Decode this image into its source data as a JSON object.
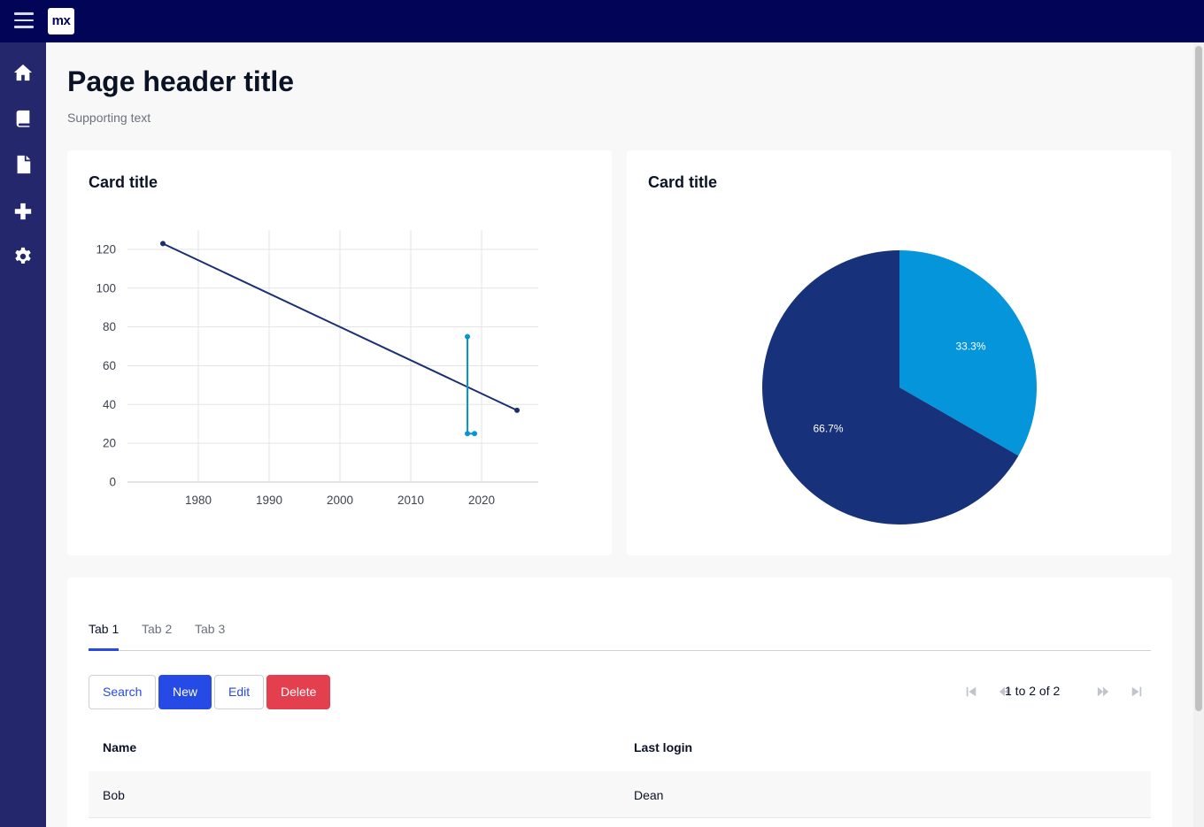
{
  "app": {
    "logo_text": "mx"
  },
  "sidebar": {
    "items": [
      {
        "icon": "home-icon"
      },
      {
        "icon": "book-icon"
      },
      {
        "icon": "file-icon"
      },
      {
        "icon": "plus-icon"
      },
      {
        "icon": "gear-icon"
      }
    ]
  },
  "page": {
    "title": "Page header title",
    "subtitle": "Supporting text"
  },
  "cards": {
    "line_title": "Card title",
    "pie_title": "Card title"
  },
  "chart_data": [
    {
      "type": "line",
      "title": "",
      "xlabel": "",
      "ylabel": "",
      "xlim": [
        1970,
        2028
      ],
      "ylim": [
        0,
        130
      ],
      "x_ticks": [
        "1980",
        "1990",
        "2000",
        "2010",
        "2020"
      ],
      "y_ticks": [
        "0",
        "20",
        "40",
        "60",
        "80",
        "100",
        "120"
      ],
      "grid": true,
      "series": [
        {
          "color": "#1a2f72",
          "points": [
            [
              1975,
              123
            ],
            [
              2025,
              37
            ]
          ]
        },
        {
          "color": "#0595db",
          "points": [
            [
              2018,
              75
            ],
            [
              2018,
              25
            ],
            [
              2019,
              25
            ]
          ]
        }
      ]
    },
    {
      "type": "pie",
      "slices": [
        {
          "label": "33.3%",
          "value": 33.3,
          "color": "#0595db"
        },
        {
          "label": "66.7%",
          "value": 66.7,
          "color": "#17327a"
        }
      ]
    }
  ],
  "tabs": [
    "Tab 1",
    "Tab 2",
    "Tab 3"
  ],
  "toolbar": {
    "search": "Search",
    "new": "New",
    "edit": "Edit",
    "delete": "Delete"
  },
  "pager": {
    "text": "1 to 2 of 2"
  },
  "table": {
    "headers": [
      "Name",
      "Last login"
    ],
    "rows": [
      [
        "Bob",
        "Dean"
      ]
    ]
  }
}
